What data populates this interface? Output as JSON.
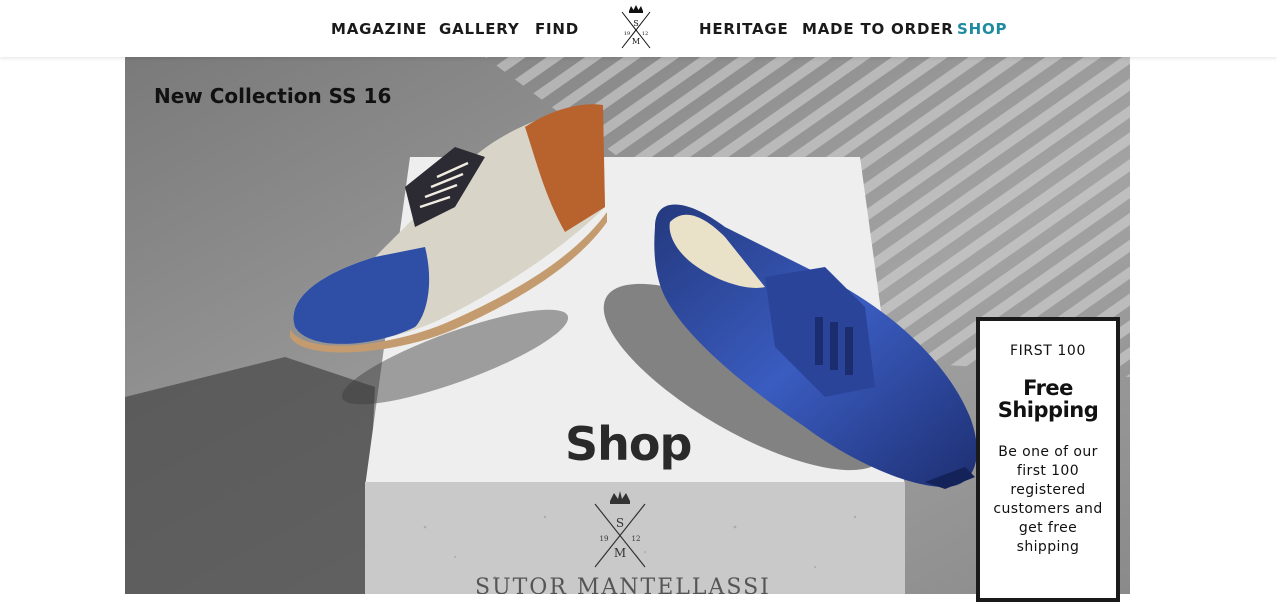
{
  "nav": {
    "left": [
      "MAGAZINE",
      "GALLERY",
      "FIND"
    ],
    "right": [
      "HERITAGE",
      "MADE TO ORDER",
      "SHOP"
    ],
    "active": "SHOP",
    "logo_monogram": "S M 1912"
  },
  "hero": {
    "caption": "New Collection SS 16",
    "title": "Shop",
    "brand_text": "SUTOR MANTELLASSI"
  },
  "promo": {
    "heading": "FIRST 100",
    "title": "Free Shipping",
    "body": "Be one of our first 100 registered customers and get free shipping"
  },
  "colors": {
    "active_nav": "#1f8aa0",
    "shoe_blue": "#2f4fa6",
    "box_border": "#1a1a1a"
  }
}
